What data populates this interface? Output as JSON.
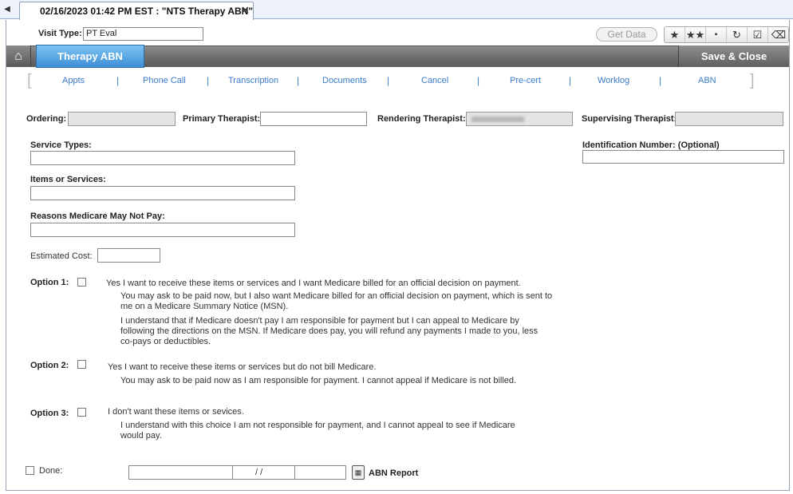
{
  "tab": {
    "title": "02/16/2023 01:42 PM EST : \"NTS Therapy ABN\"",
    "close": "✕",
    "arrow": "◀"
  },
  "visit": {
    "label": "Visit Type:",
    "value": "PT Eval"
  },
  "toolbar": {
    "get_data": "Get Data"
  },
  "nav": {
    "active_tab": "Therapy ABN",
    "save_close": "Save & Close"
  },
  "links": [
    "Appts",
    "Phone Call",
    "Transcription",
    "Documents",
    "Cancel",
    "Pre-cert",
    "Worklog",
    "ABN"
  ],
  "fields": {
    "ordering": "Ordering:",
    "primary_therapist": "Primary Therapist:",
    "rendering_therapist": "Rendering Therapist:",
    "supervising_therapist": "Supervising Therapist:",
    "service_types": "Service Types:",
    "identification": "Identification Number:  (Optional)",
    "items": "Items or Services:",
    "reasons": "Reasons Medicare May Not Pay:",
    "estimated_cost": "Estimated Cost:"
  },
  "options": [
    {
      "label": "Option 1:",
      "main": "Yes I want to receive these items or services and I want Medicare billed for an official decision on payment.",
      "p1": "You may ask to be paid now, but I also want Medicare billed for an official decision on payment, which is sent to",
      "p2": "me on a Medicare Summary Notice (MSN).",
      "p3": "I understand that if Medicare doesn't pay I am responsible for payment but I can appeal to Medicare by",
      "p4": "following the directions on the MSN. If Medicare does pay, you will refund any payments I made to you, less",
      "p5": "co-pays or deductibles."
    },
    {
      "label": "Option 2:",
      "main": "Yes I want to receive these items or services but do not bill Medicare.",
      "p1": "You may ask to be paid now as I am responsible for payment. I cannot appeal if Medicare is not billed."
    },
    {
      "label": "Option 3:",
      "main": "I don't want these items or sevices.",
      "p1": "I understand with this choice I am not responsible for payment, and I cannot appeal to see if Medicare",
      "p2": "would pay."
    }
  ],
  "done": {
    "label": "Done:",
    "date_sep": "/ /",
    "report": "ABN Report"
  }
}
